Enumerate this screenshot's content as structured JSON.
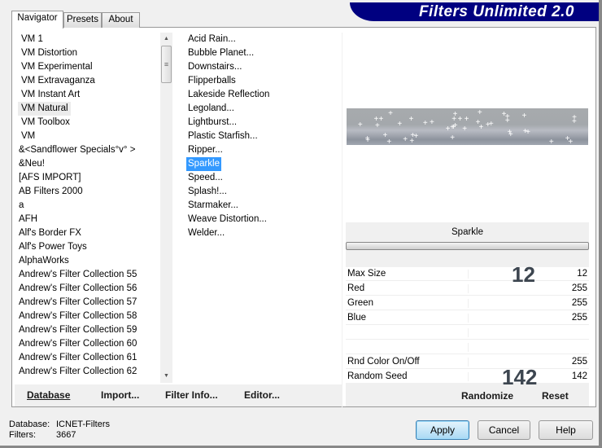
{
  "title": "Filters Unlimited 2.0",
  "tabs": [
    {
      "label": "Navigator"
    },
    {
      "label": "Presets"
    },
    {
      "label": "About"
    }
  ],
  "categories": [
    "VM 1",
    "VM Distortion",
    "VM Experimental",
    "VM Extravaganza",
    "VM Instant Art",
    "VM Natural",
    "VM Toolbox",
    "VM",
    "&<Sandflower Specials°v° >",
    "&Neu!",
    "[AFS IMPORT]",
    "AB Filters 2000",
    "a",
    "AFH",
    "Alf's Border FX",
    "Alf's Power Toys",
    "AlphaWorks",
    "Andrew's Filter Collection 55",
    "Andrew's Filter Collection 56",
    "Andrew's Filter Collection 57",
    "Andrew's Filter Collection 58",
    "Andrew's Filter Collection 59",
    "Andrew's Filter Collection 60",
    "Andrew's Filter Collection 61",
    "Andrew's Filter Collection 62"
  ],
  "selected_category": "VM Natural",
  "filters": [
    "Acid Rain...",
    "Bubble Planet...",
    "Downstairs...",
    "Flipperballs",
    "Lakeside Reflection",
    "Legoland...",
    "Lightburst...",
    "Plastic Starfish...",
    "Ripper...",
    "Sparkle",
    "Speed...",
    "Splash!...",
    "Starmaker...",
    "Weave Distortion...",
    "Welder..."
  ],
  "selected_filter": "Sparkle",
  "left_buttons": {
    "database": "Database",
    "import": "Import...",
    "filter_info": "Filter Info...",
    "editor": "Editor..."
  },
  "filter_name": "Sparkle",
  "params": [
    {
      "label": "Max Size",
      "value": "12"
    },
    {
      "label": "Red",
      "value": "255"
    },
    {
      "label": "Green",
      "value": "255"
    },
    {
      "label": "Blue",
      "value": "255"
    },
    {
      "label": "",
      "value": ""
    },
    {
      "label": "",
      "value": ""
    },
    {
      "label": "Rnd Color On/Off",
      "value": "255"
    },
    {
      "label": "Random Seed",
      "value": "142"
    }
  ],
  "big_values": {
    "max_size": "12",
    "random_seed": "142"
  },
  "right_buttons": {
    "randomize": "Randomize",
    "reset": "Reset"
  },
  "status": {
    "database_label": "Database:",
    "database_value": "ICNET-Filters",
    "filters_label": "Filters:",
    "filters_value": "3667"
  },
  "dialog_buttons": {
    "apply": "Apply",
    "cancel": "Cancel",
    "help": "Help"
  },
  "colors": {
    "banner": "#000080",
    "selection": "#3399ff"
  }
}
